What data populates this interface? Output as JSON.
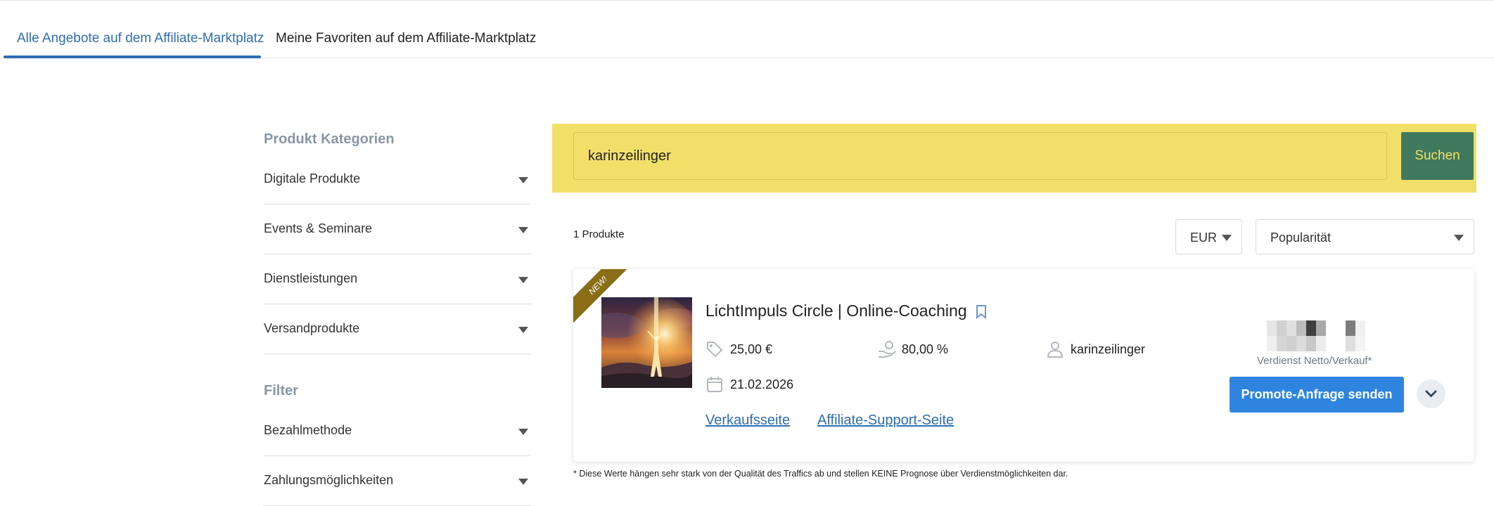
{
  "tabs": [
    {
      "label": "Alle Angebote auf dem Affiliate-Marktplatz",
      "active": true
    },
    {
      "label": "Meine Favoriten auf dem Affiliate-Marktplatz",
      "active": false
    }
  ],
  "sidebar": {
    "categories_heading": "Produkt Kategorien",
    "categories": [
      "Digitale Produkte",
      "Events & Seminare",
      "Dienstleistungen",
      "Versandprodukte"
    ],
    "filter_heading": "Filter",
    "filters": [
      "Bezahlmethode",
      "Zahlungsmöglichkeiten"
    ]
  },
  "search": {
    "value": "karinzeilinger",
    "button_label": "Suchen",
    "band_color": "#f2df69",
    "button_color": "#3f7a5c"
  },
  "results": {
    "count_label": "1 Produkte",
    "currency": "EUR",
    "sort": "Popularität"
  },
  "product": {
    "badge": "NEW!",
    "title": "LichtImpuls Circle | Online-Coaching",
    "price": "25,00 €",
    "commission": "80,00 %",
    "vendor": "karinzeilinger",
    "date": "21.02.2026",
    "links": {
      "sales": "Verkaufsseite",
      "support": "Affiliate-Support-Seite"
    },
    "earnings_label": "Verdienst Netto/Verkauf*",
    "promote_label": "Promote-Anfrage senden",
    "icons": {
      "price": "price-tag-icon",
      "commission": "hand-coin-icon",
      "vendor": "user-icon",
      "date": "calendar-icon",
      "bookmark": "bookmark-icon",
      "expand": "chevron-down-icon"
    }
  },
  "disclaimer": "* Diese Werte hängen sehr stark von der Qualität des Traffics ab und stellen KEINE Prognose über Verdienstmöglichkeiten dar.",
  "colors": {
    "accent": "#2f6db5",
    "promote": "#2f84e0",
    "badge": "#8a6d14"
  }
}
